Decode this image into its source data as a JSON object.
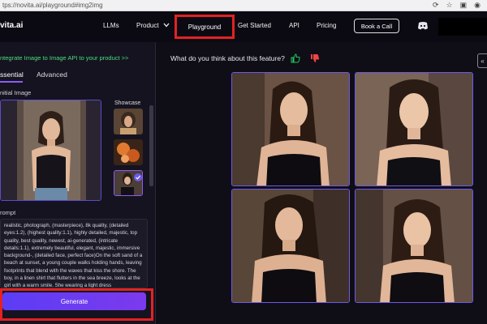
{
  "browser": {
    "url": "tps://novita.ai/playground#img2img"
  },
  "nav": {
    "logo": "vita.ai",
    "items": [
      "LLMs",
      "Product",
      "Playground",
      "Get Started",
      "API",
      "Pricing"
    ],
    "product_chevron": "chevron-down-icon",
    "book_call": "Book a Call"
  },
  "left": {
    "promo": "ntegrate Image to Image API to your product >>",
    "tabs": [
      "ssential",
      "Advanced"
    ],
    "initial_image_label": "nitial Image",
    "showcase_label": "Showcase",
    "prompt_label": "rompt",
    "prompt_text": "realistic, photograph, (masterpiece), 8k quality, (detailed eyes:1.2), (highest quality:1.1), highly detailed, majestic, top quality, best quality, newest, ai-generated, (intricate details:1.1), extremely beautiful, elegant, majestic, immersive background-, (detailed face, perfect face)On the soft sand of a beach at sunset, a young couple walks holding hands, leaving footprints that blend with the waves that kiss the shore. The boy, in a linen shirt that flutters in the sea breeze, looks at the girl with a warm smile. She wearing a light dress",
    "generate_label": "Generate"
  },
  "main": {
    "feedback_question": "What do you think about this feature?",
    "side_tab": "«"
  },
  "colors": {
    "accent": "#7c3aed",
    "highlight": "#e32222",
    "thumb_up": "#22c55e",
    "thumb_down": "#ef4444",
    "promo": "#4ade80"
  }
}
